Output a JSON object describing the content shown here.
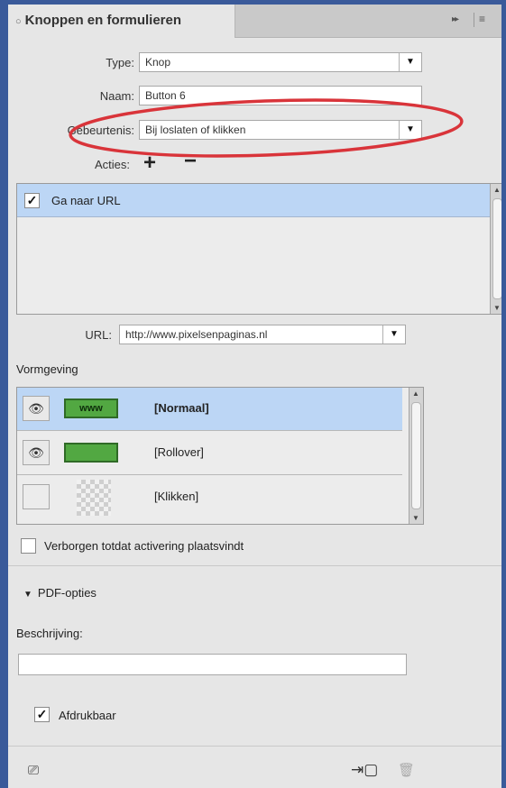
{
  "panel": {
    "tab_title": "Knoppen en formulieren",
    "close_glyph": "○",
    "collapse_glyph": "▸▸",
    "menu_glyph": "≡"
  },
  "form": {
    "type_label": "Type:",
    "type_value": "Knop",
    "name_label": "Naam:",
    "name_value": "Button 6",
    "event_label": "Gebeurtenis:",
    "event_value": "Bij loslaten of klikken",
    "actions_label": "Acties:",
    "add_glyph": "+",
    "remove_glyph": "−",
    "dropdown_glyph": "▼"
  },
  "actions_list": {
    "items": [
      {
        "label": "Ga naar URL",
        "checked": true
      }
    ]
  },
  "url": {
    "label": "URL:",
    "value": "http://www.pixelsenpaginas.nl"
  },
  "appearance": {
    "heading": "Vormgeving",
    "states": [
      {
        "name": "[Normaal]",
        "thumbnail_text": "www",
        "visible": true,
        "selected": true
      },
      {
        "name": "[Rollover]",
        "thumbnail_text": "",
        "visible": true,
        "selected": false
      },
      {
        "name": "[Klikken]",
        "thumbnail_text": "",
        "visible": false,
        "selected": false
      }
    ]
  },
  "hidden_option": {
    "label": "Verborgen totdat activering plaatsvindt",
    "checked": false
  },
  "pdf": {
    "heading": "PDF-opties",
    "description_label": "Beschrijving:",
    "description_value": "",
    "printable_label": "Afdrukbaar",
    "printable_checked": true
  },
  "colors": {
    "highlight_ring": "#d9343a",
    "selection": "#bcd6f5",
    "panel_bg": "#e6e6e6",
    "frame_bg": "#3a5a9a"
  }
}
